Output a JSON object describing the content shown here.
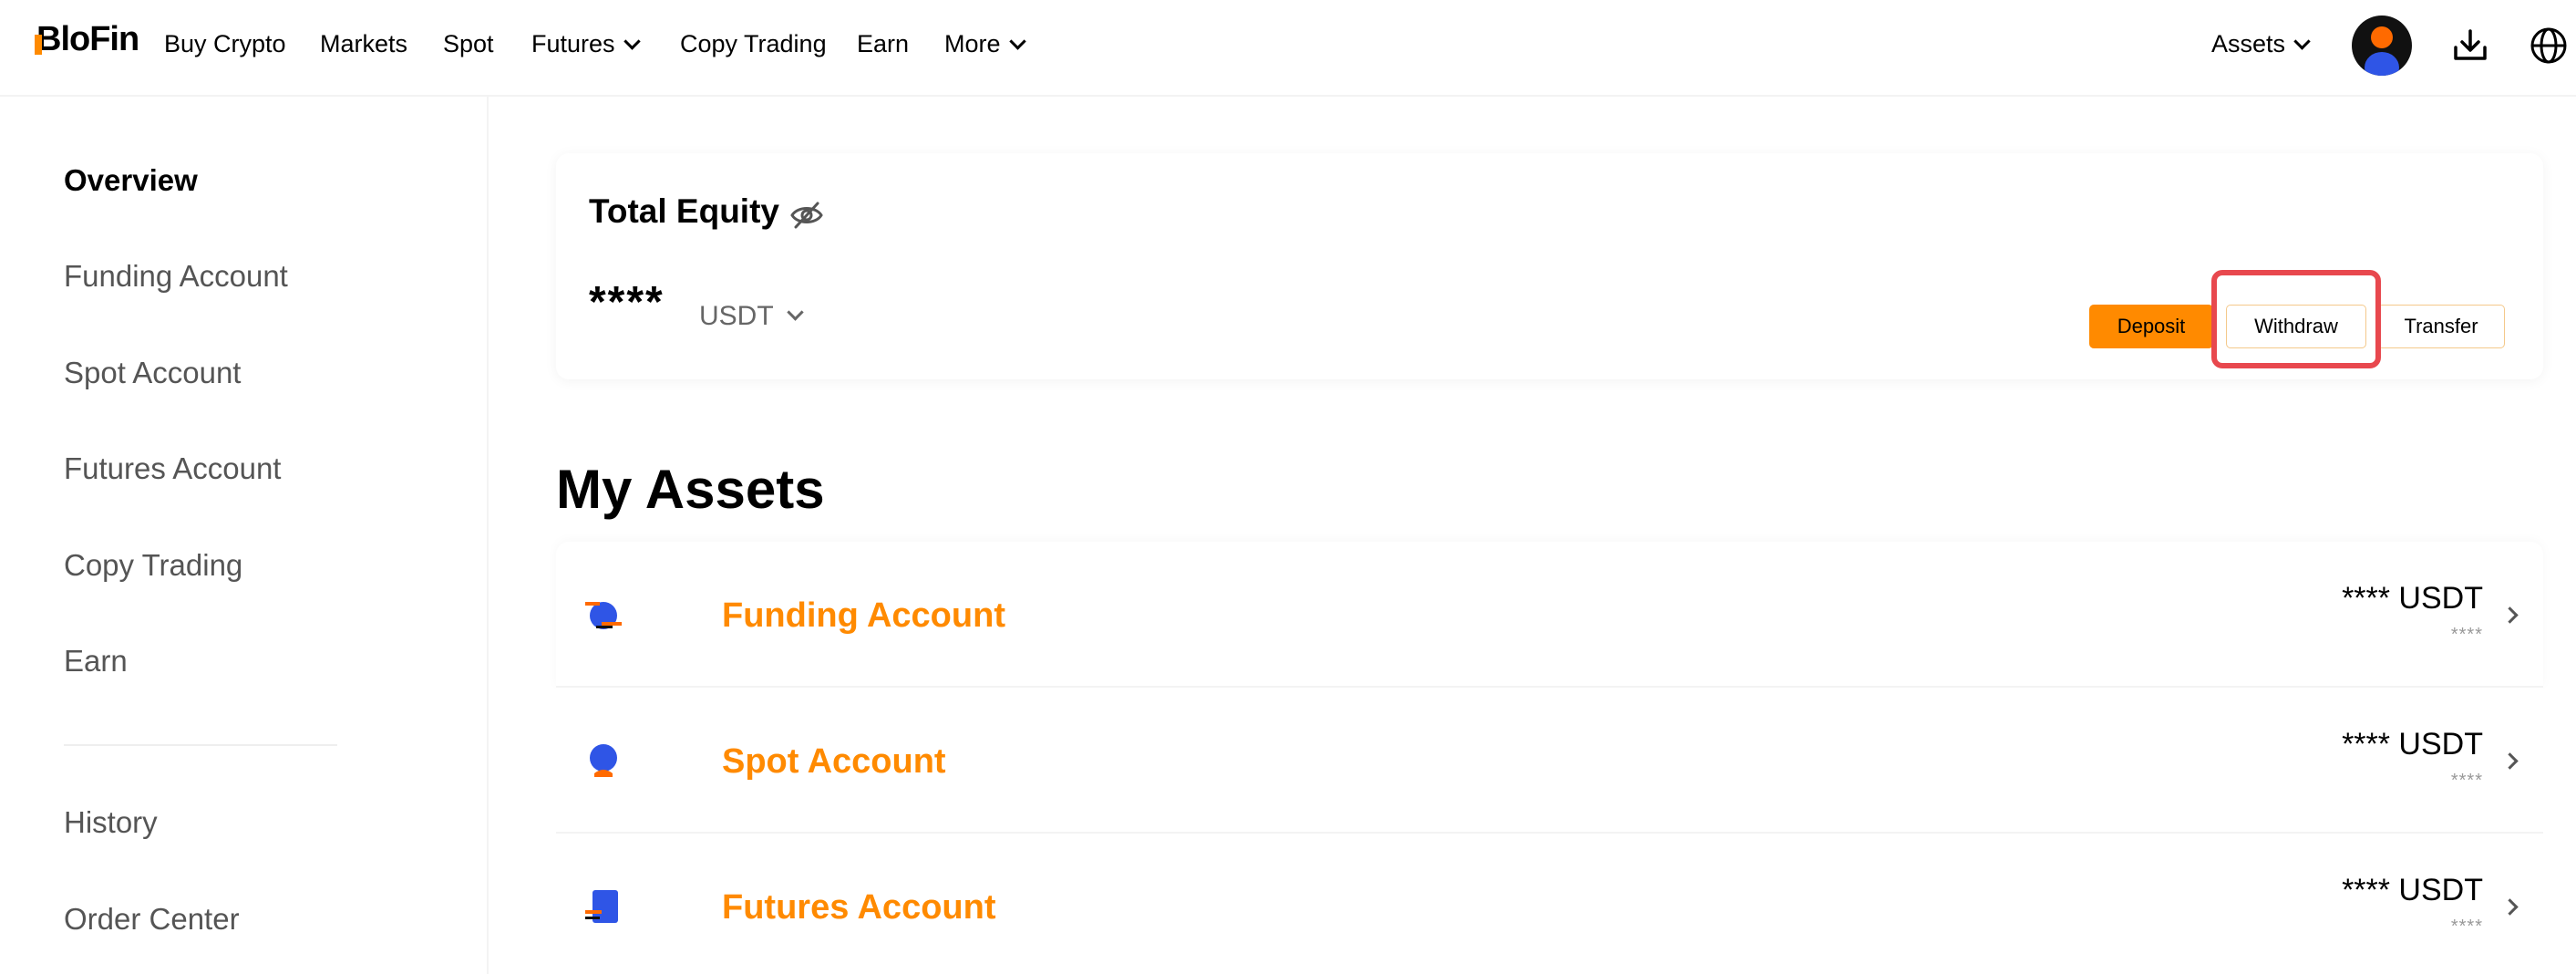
{
  "brand": {
    "logo_text": "BloFin",
    "accent_color": "#ff8a00",
    "highlight_color": "#e8484e"
  },
  "nav": {
    "items": [
      {
        "label": "Buy Crypto",
        "dropdown": false
      },
      {
        "label": "Markets",
        "dropdown": false
      },
      {
        "label": "Spot",
        "dropdown": false
      },
      {
        "label": "Futures",
        "dropdown": true
      },
      {
        "label": "Copy Trading",
        "dropdown": false
      },
      {
        "label": "Earn",
        "dropdown": false
      },
      {
        "label": "More",
        "dropdown": true
      }
    ],
    "assets_label": "Assets",
    "icons": [
      "avatar",
      "download-icon",
      "globe-icon"
    ]
  },
  "sidebar": {
    "items": [
      {
        "label": "Overview",
        "active": true
      },
      {
        "label": "Funding Account",
        "active": false
      },
      {
        "label": "Spot Account",
        "active": false
      },
      {
        "label": "Futures Account",
        "active": false
      },
      {
        "label": "Copy Trading",
        "active": false
      },
      {
        "label": "Earn",
        "active": false
      }
    ],
    "secondary_items": [
      {
        "label": "History"
      },
      {
        "label": "Order Center"
      }
    ]
  },
  "equity": {
    "title": "Total Equity",
    "value": "****",
    "currency": "USDT",
    "buttons": {
      "deposit": "Deposit",
      "withdraw": "Withdraw",
      "transfer": "Transfer"
    }
  },
  "my_assets": {
    "title": "My Assets",
    "rows": [
      {
        "name": "Funding Account",
        "value": "**** USDT",
        "sub": "****",
        "icon": "funding-account-icon"
      },
      {
        "name": "Spot Account",
        "value": "**** USDT",
        "sub": "****",
        "icon": "spot-account-icon"
      },
      {
        "name": "Futures Account",
        "value": "**** USDT",
        "sub": "****",
        "icon": "futures-account-icon"
      }
    ]
  }
}
